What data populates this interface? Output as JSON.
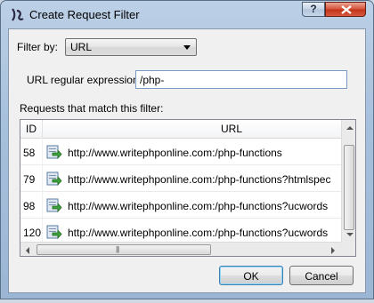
{
  "window": {
    "title": "Create Request Filter"
  },
  "filter_by": {
    "label": "Filter by:",
    "selected": "URL"
  },
  "regex": {
    "label": "URL regular expression:",
    "value": "/php-"
  },
  "matches": {
    "label": "Requests that match this filter:",
    "columns": [
      "ID",
      "URL"
    ],
    "rows": [
      {
        "id": "58",
        "url": "http://www.writephponline.com:/php-functions"
      },
      {
        "id": "79",
        "url": "http://www.writephponline.com:/php-functions?htmlspec"
      },
      {
        "id": "98",
        "url": "http://www.writephponline.com:/php-functions?ucwords"
      },
      {
        "id": "120",
        "url": "http://www.writephponline.com:/php-functions?ucwords"
      }
    ]
  },
  "buttons": {
    "ok": "OK",
    "cancel": "Cancel"
  },
  "icons": {
    "app": "fiddler-app-icon",
    "help": "help-icon",
    "close": "close-icon",
    "request": "request-arrow-icon"
  }
}
